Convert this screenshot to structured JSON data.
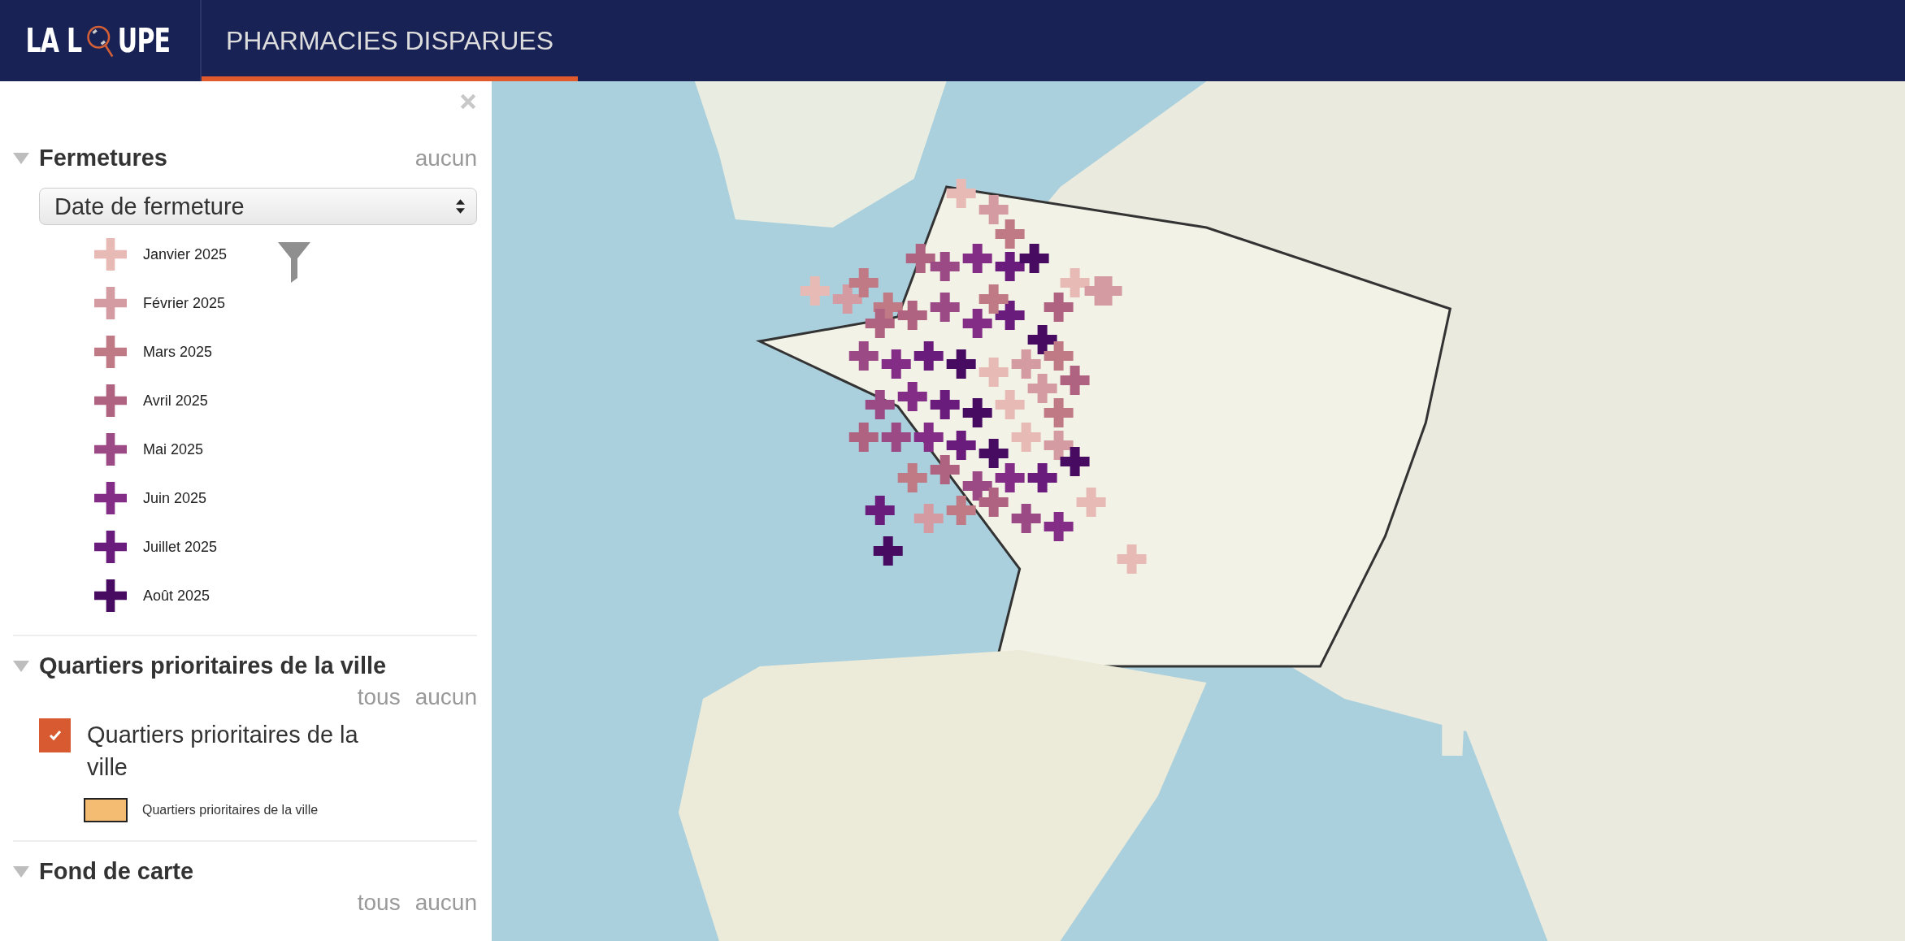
{
  "header": {
    "logo": {
      "before_lens": "LA L",
      "after_lens": "UPE"
    },
    "tabs": [
      {
        "label": "PHARMACIES DISPARUES",
        "selected": true
      }
    ]
  },
  "sidebar": {
    "sections": [
      {
        "kind": "legend",
        "title": "Fermetures",
        "expanded": true,
        "actions": [
          "aucun"
        ],
        "select": {
          "value": "Date de fermeture"
        },
        "items": [
          {
            "label": "Janvier 2025",
            "color": "#e8bab6"
          },
          {
            "label": "Février 2025",
            "color": "#d59ba3"
          },
          {
            "label": "Mars 2025",
            "color": "#c07a85"
          },
          {
            "label": "Avril 2025",
            "color": "#b06381"
          },
          {
            "label": "Mai 2025",
            "color": "#9b4a86"
          },
          {
            "label": "Juin 2025",
            "color": "#842d86"
          },
          {
            "label": "Juillet 2025",
            "color": "#6a1c7c"
          },
          {
            "label": "Août 2025",
            "color": "#470b62"
          }
        ]
      },
      {
        "kind": "layers",
        "title": "Quartiers prioritaires de la ville",
        "expanded": true,
        "actions": [
          "tous",
          "aucun"
        ],
        "layers": [
          {
            "label": "Quartiers prioritaires de la ville",
            "checked": true,
            "swatch_label": "Quartiers prioritaires de la ville",
            "color": "#f4bb73"
          }
        ]
      },
      {
        "kind": "layers",
        "title": "Fond de carte",
        "expanded": true,
        "actions": [
          "tous",
          "aucun"
        ]
      }
    ]
  }
}
